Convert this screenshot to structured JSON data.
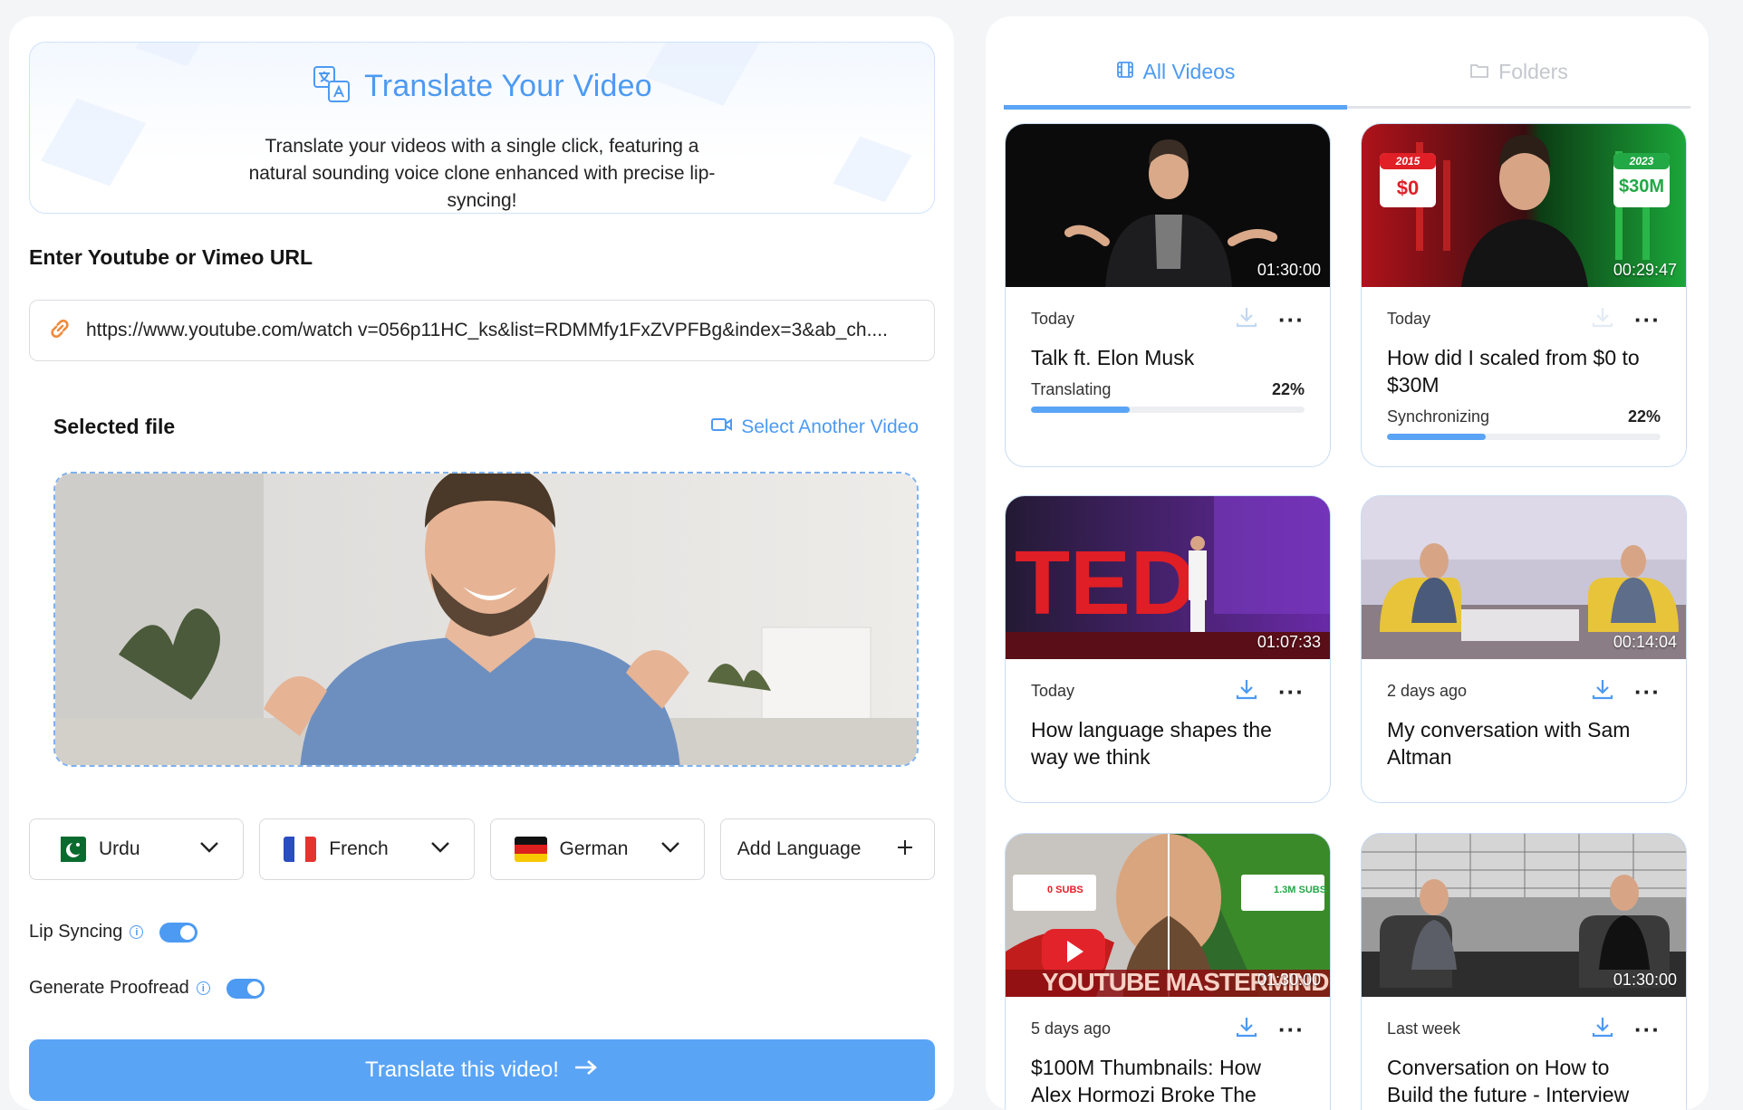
{
  "hero": {
    "title": "Translate Your Video",
    "description": "Translate your videos with a single click, featuring a natural sounding voice clone enhanced with precise lip-syncing!"
  },
  "url_section": {
    "label": "Enter Youtube or Vimeo URL",
    "value": "https://www.youtube.com/watch v=056p11HC_ks&list=RDMMfy1FxZVPFBg&index=3&ab_ch...."
  },
  "selected": {
    "label": "Selected file",
    "select_another": "Select Another Video"
  },
  "languages": [
    {
      "name": "Urdu",
      "flag": "pakistan-flag-icon"
    },
    {
      "name": "French",
      "flag": "france-flag-icon"
    },
    {
      "name": "German",
      "flag": "germany-flag-icon"
    }
  ],
  "add_language": "Add Language",
  "options": {
    "lip_syncing": "Lip Syncing",
    "lip_syncing_on": true,
    "proofread": "Generate Proofread",
    "proofread_on": true
  },
  "cta": "Translate this video!",
  "tabs": {
    "all_videos": "All Videos",
    "folders": "Folders"
  },
  "videos": [
    {
      "title": "Talk ft. Elon Musk",
      "date": "Today",
      "duration": "01:30:00",
      "status": "Translating",
      "progress": "22%"
    },
    {
      "title": "How did I scaled from $0 to $30M",
      "date": "Today",
      "duration": "00:29:47",
      "status": "Synchronizing",
      "progress": "22%",
      "thumb_left_year": "2015",
      "thumb_left_amount": "$0",
      "thumb_right_year": "2023",
      "thumb_right_amount": "$30M"
    },
    {
      "title": "How language shapes the way we think",
      "date": "Today",
      "duration": "01:07:33"
    },
    {
      "title": "My conversation with Sam Altman",
      "date": "2 days ago",
      "duration": "00:14:04"
    },
    {
      "title": "$100M Thumbnails: How Alex Hormozi Broke The",
      "date": "5 days ago",
      "duration": "01:30:00",
      "thumb_caption": "YOUTUBE MASTERMIND?",
      "thumb_left_badge": "0 SUBS",
      "thumb_right_badge": "1.3M SUBS"
    },
    {
      "title": "Conversation on How to Build the future - Interview",
      "date": "Last week",
      "duration": "01:30:00"
    }
  ],
  "colors": {
    "accent": "#4d9af2",
    "cta": "#5aa4f5",
    "border": "#c8dcf4"
  }
}
